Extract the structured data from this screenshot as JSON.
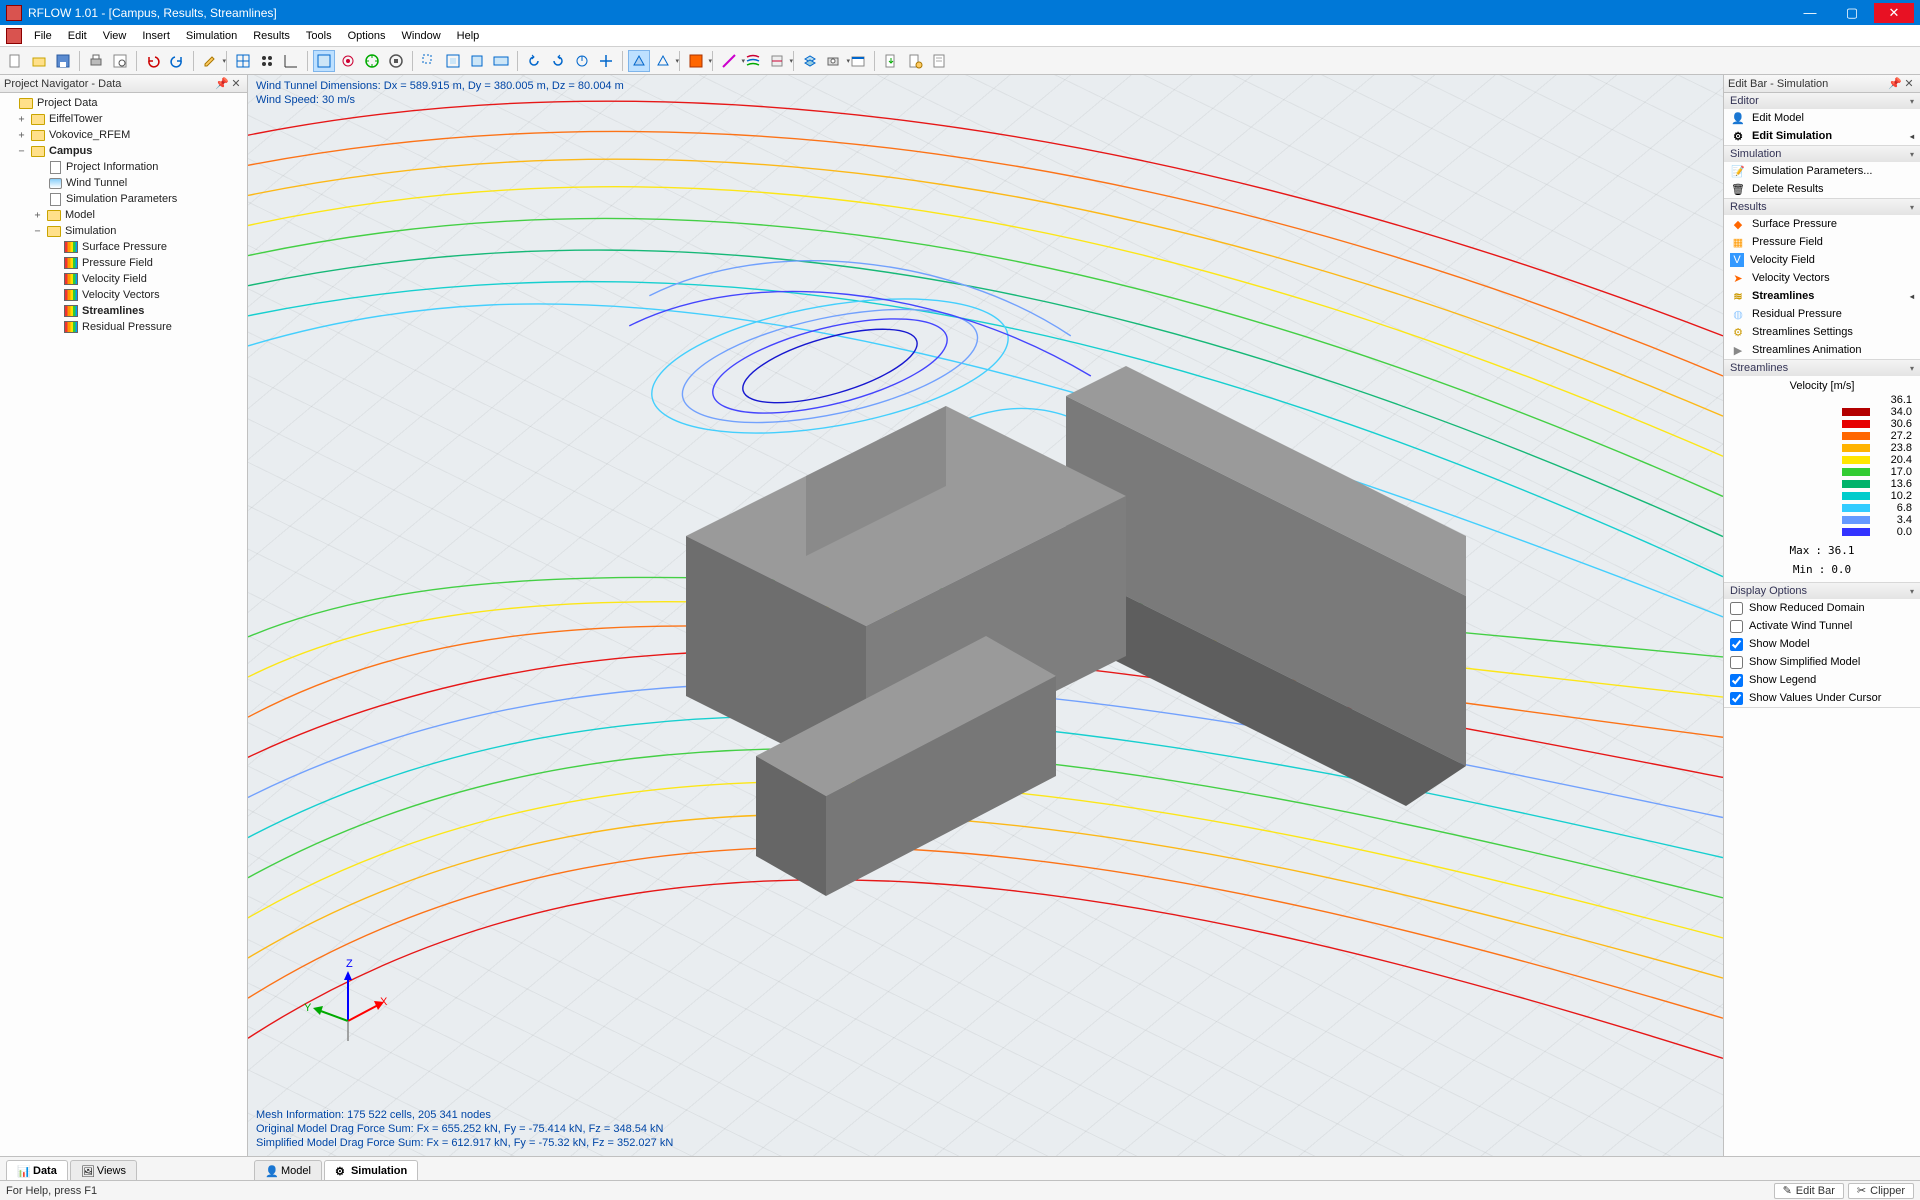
{
  "title": "RFLOW 1.01 - [Campus, Results, Streamlines]",
  "menu": [
    "File",
    "Edit",
    "View",
    "Insert",
    "Simulation",
    "Results",
    "Tools",
    "Options",
    "Window",
    "Help"
  ],
  "nav_title": "Project Navigator - Data",
  "tree": {
    "root": "Project Data",
    "eiffel": "EiffelTower",
    "vokovice": "Vokovice_RFEM",
    "campus": "Campus",
    "proj_info": "Project Information",
    "wind_tunnel": "Wind Tunnel",
    "sim_params": "Simulation Parameters",
    "model": "Model",
    "simulation": "Simulation",
    "surface_pressure": "Surface Pressure",
    "pressure_field": "Pressure Field",
    "velocity_field": "Velocity Field",
    "velocity_vectors": "Velocity Vectors",
    "streamlines": "Streamlines",
    "residual_pressure": "Residual Pressure"
  },
  "overlay": {
    "line1": "Wind Tunnel Dimensions: Dx = 589.915 m, Dy = 380.005 m, Dz = 80.004 m",
    "line2": "Wind Speed: 30 m/s",
    "mesh": "Mesh Information: 175 522 cells, 205 341 nodes",
    "drag1": "Original Model Drag Force Sum: Fx = 655.252 kN, Fy = -75.414 kN, Fz = 348.54 kN",
    "drag2": "Simplified Model Drag Force Sum: Fx = 612.917 kN, Fy = -75.32 kN, Fz = 352.027 kN"
  },
  "axis": {
    "z": "Z",
    "x": "X",
    "y": "Y"
  },
  "editbar": {
    "title": "Edit Bar - Simulation",
    "editor_hdr": "Editor",
    "edit_model": "Edit Model",
    "edit_sim": "Edit Simulation",
    "sim_hdr": "Simulation",
    "sim_params": "Simulation Parameters...",
    "del_results": "Delete Results",
    "results_hdr": "Results",
    "surface_pressure": "Surface Pressure",
    "pressure_field": "Pressure Field",
    "velocity_field": "Velocity Field",
    "velocity_vectors": "Velocity Vectors",
    "streamlines": "Streamlines",
    "residual_pressure": "Residual Pressure",
    "sl_settings": "Streamlines Settings",
    "sl_anim": "Streamlines Animation",
    "streamlines_hdr": "Streamlines",
    "legend_title": "Velocity [m/s]",
    "legend": [
      {
        "v": "36.1",
        "c": "#b30000"
      },
      {
        "v": "34.0",
        "c": "#e60000"
      },
      {
        "v": "30.6",
        "c": "#ff6600"
      },
      {
        "v": "27.2",
        "c": "#ffb300"
      },
      {
        "v": "23.8",
        "c": "#ffe600"
      },
      {
        "v": "20.4",
        "c": "#33cc33"
      },
      {
        "v": "17.0",
        "c": "#00b36b"
      },
      {
        "v": "13.6",
        "c": "#00cccc"
      },
      {
        "v": "10.2",
        "c": "#33ccff"
      },
      {
        "v": "6.8",
        "c": "#6699ff"
      },
      {
        "v": "3.4",
        "c": "#3333ff"
      },
      {
        "v": "0.0",
        "c": "#0000cc"
      }
    ],
    "max_lbl": "Max",
    "max_val": "36.1",
    "min_lbl": "Min",
    "min_val": "0.0",
    "disp_hdr": "Display Options",
    "opts": [
      {
        "label": "Show Reduced Domain",
        "checked": false
      },
      {
        "label": "Activate Wind Tunnel",
        "checked": false
      },
      {
        "label": "Show Model",
        "checked": true
      },
      {
        "label": "Show Simplified Model",
        "checked": false
      },
      {
        "label": "Show Legend",
        "checked": true
      },
      {
        "label": "Show Values Under Cursor",
        "checked": true
      }
    ]
  },
  "left_tabs": {
    "data": "Data",
    "views": "Views"
  },
  "vp_tabs": {
    "model": "Model",
    "sim": "Simulation"
  },
  "status": {
    "help": "For Help, press F1",
    "editbar": "Edit Bar",
    "clipper": "Clipper"
  }
}
